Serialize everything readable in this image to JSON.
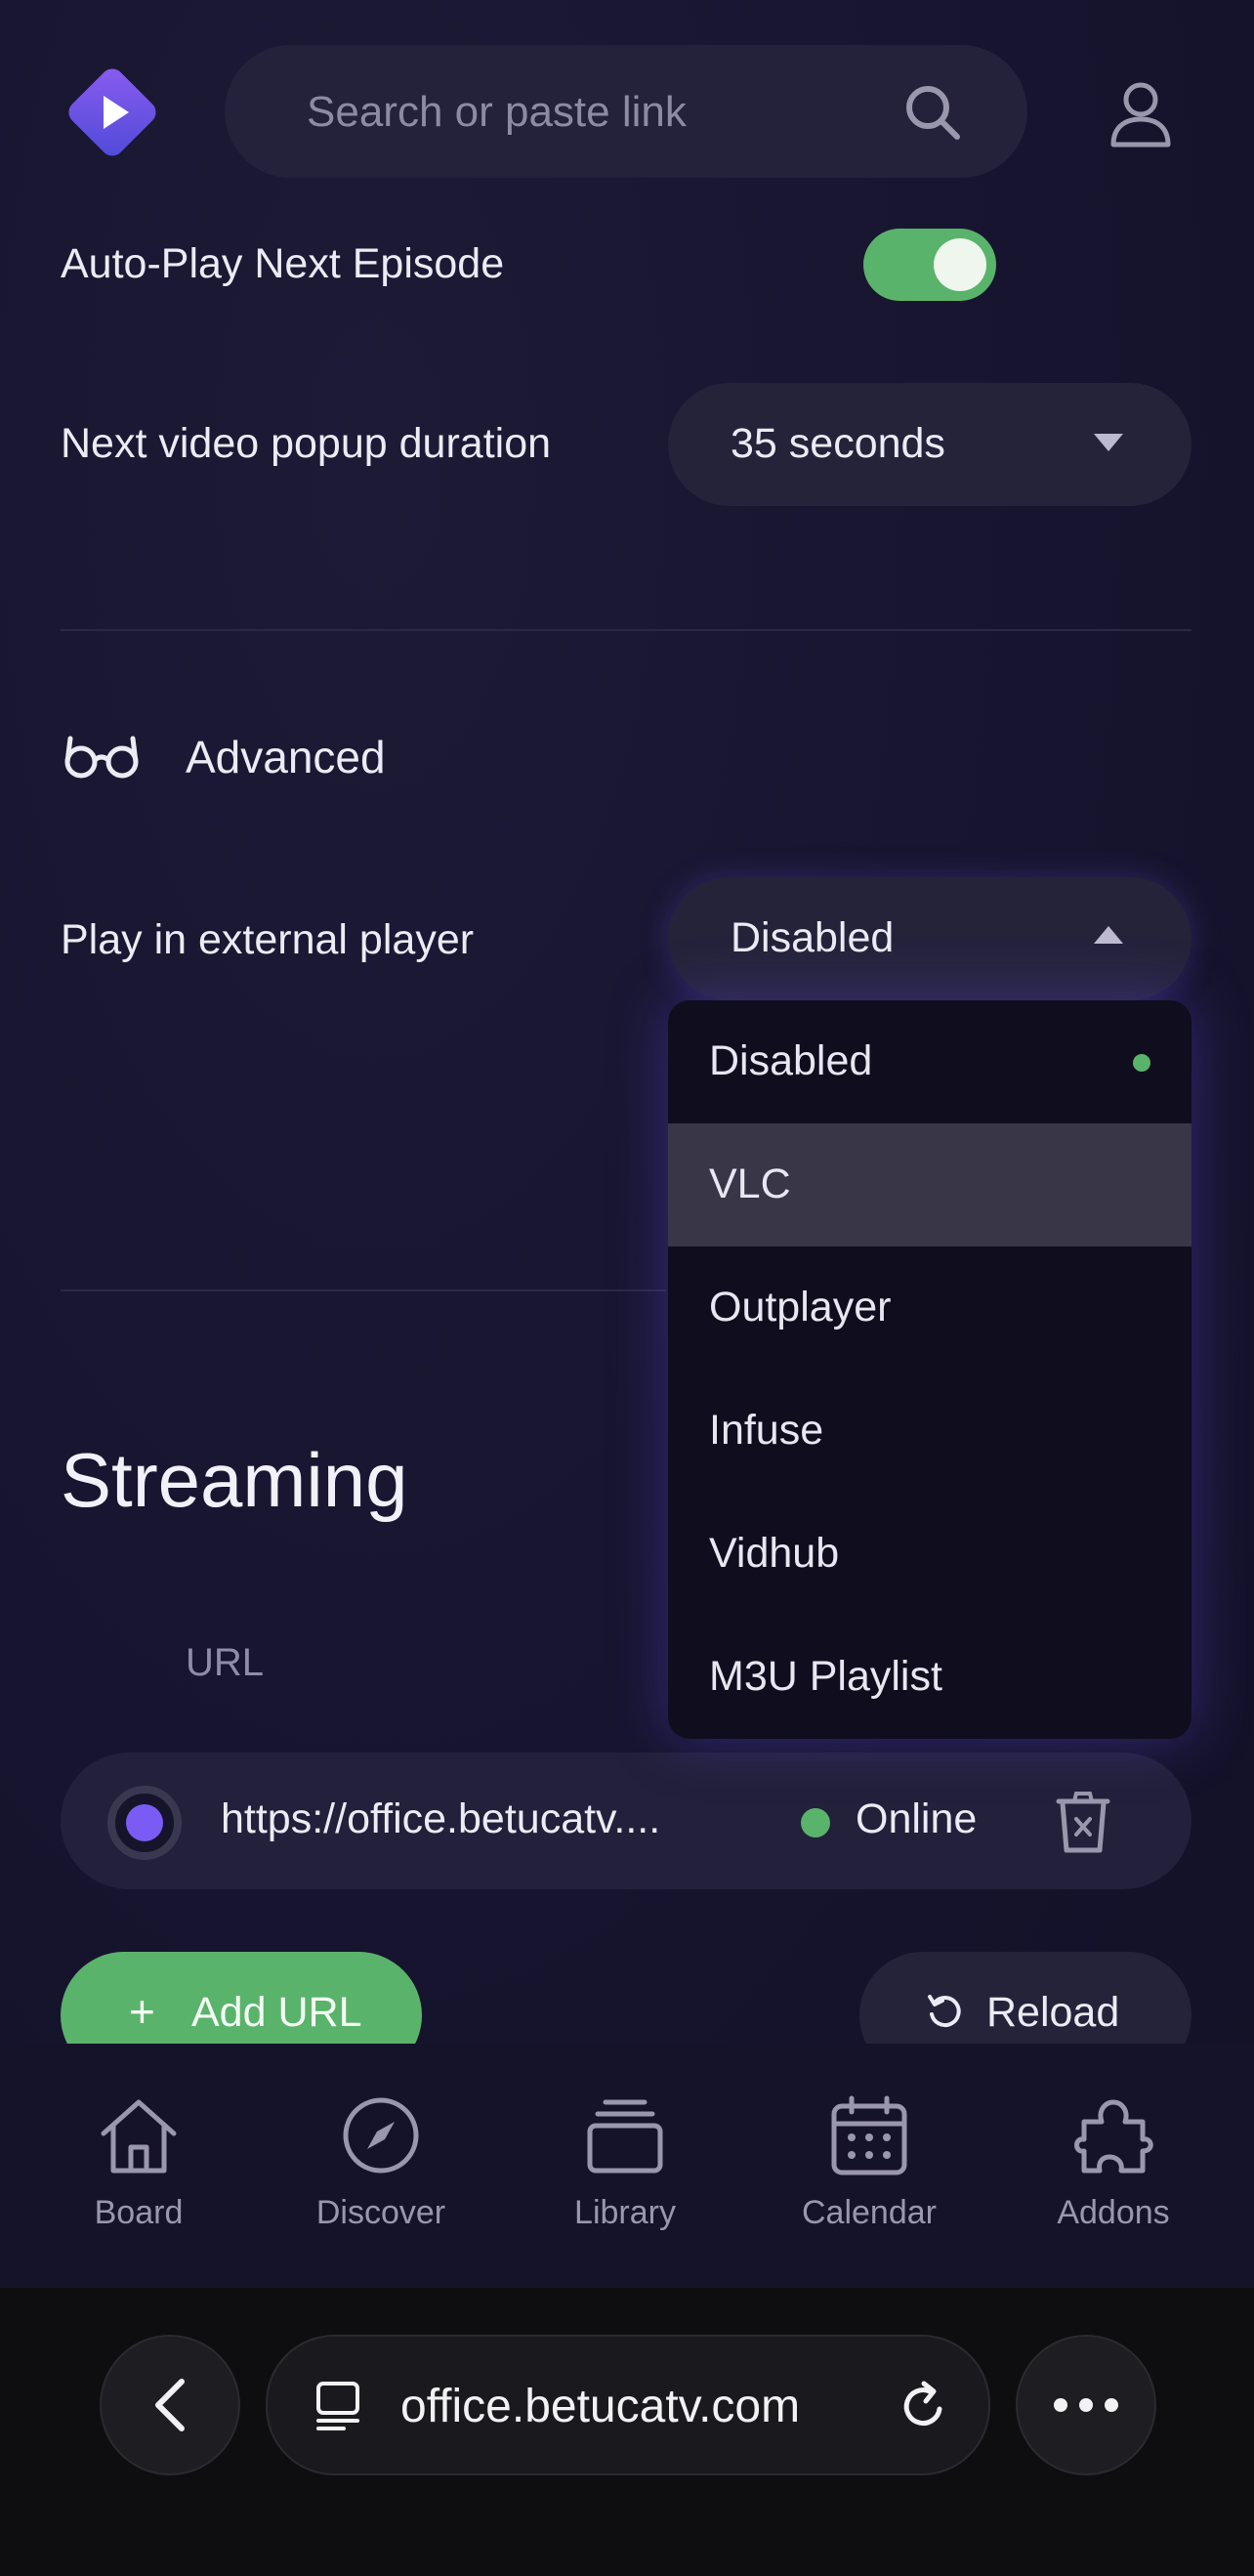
{
  "header": {
    "search_placeholder": "Search or paste link",
    "logo_icon": "play-diamond-logo",
    "profile_icon": "user-icon"
  },
  "player": {
    "autoplay_label": "Auto-Play Next Episode",
    "autoplay_on": true,
    "popup_label": "Next video popup duration",
    "popup_value": "35 seconds"
  },
  "advanced": {
    "section_label": "Advanced",
    "section_icon": "glasses-icon",
    "external_label": "Play in external player",
    "external_value": "Disabled",
    "options": [
      "Disabled",
      "VLC",
      "Outplayer",
      "Infuse",
      "Vidhub",
      "M3U Playlist"
    ],
    "selected_option": "Disabled",
    "highlighted_option": "VLC"
  },
  "streaming": {
    "title": "Streaming",
    "column_url": "URL",
    "rows": [
      {
        "url": "https://office.betucatv....",
        "status": "Online"
      }
    ],
    "add_label": "Add URL",
    "reload_label": "Reload"
  },
  "tabs": [
    {
      "label": "Board",
      "icon": "home-icon"
    },
    {
      "label": "Discover",
      "icon": "compass-icon"
    },
    {
      "label": "Library",
      "icon": "library-icon"
    },
    {
      "label": "Calendar",
      "icon": "calendar-icon"
    },
    {
      "label": "Addons",
      "icon": "puzzle-icon"
    }
  ],
  "browser": {
    "address": "office.betucatv.com"
  },
  "colors": {
    "accent_green": "#5ab36a",
    "accent_purple": "#7a5cf5",
    "background": "#16142a"
  }
}
